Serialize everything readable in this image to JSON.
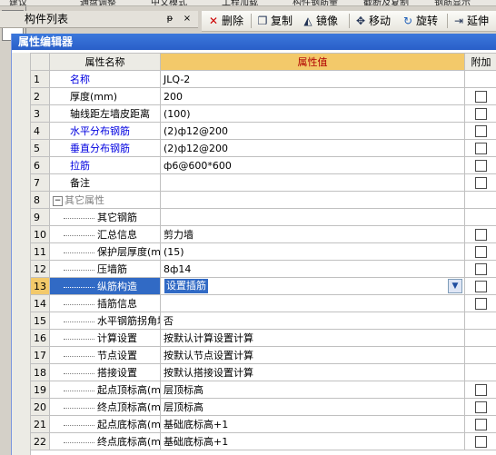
{
  "top_strip": [
    "建议",
    "通盘调整",
    "中文模式",
    "工程加载",
    "构件钢筋量",
    "截断及复制",
    "钢筋显示"
  ],
  "component_list": {
    "title": "构件列表",
    "pin": "ᵽ",
    "close": "×"
  },
  "toolbar": {
    "delete_label": "删除",
    "copy_label": "复制",
    "mirror_label": "镜像",
    "move_label": "移动",
    "rotate_label": "旋转",
    "extend_label": "延伸"
  },
  "editor": {
    "title": "属性编辑器",
    "col_name": "属性名称",
    "col_value": "属性值",
    "col_extra": "附加",
    "rows": [
      {
        "num": "1",
        "name": "名称",
        "value": "JLQ-2",
        "style": "blue",
        "indent": false,
        "check": false
      },
      {
        "num": "2",
        "name": "厚度(mm)",
        "value": "200",
        "style": "normal",
        "indent": false,
        "check": true
      },
      {
        "num": "3",
        "name": "轴线距左墙皮距离",
        "value": "(100)",
        "style": "normal",
        "indent": false,
        "check": true
      },
      {
        "num": "4",
        "name": "水平分布钢筋",
        "value": "(2)ф12@200",
        "style": "blue",
        "indent": false,
        "check": true
      },
      {
        "num": "5",
        "name": "垂直分布钢筋",
        "value": "(2)ф12@200",
        "style": "blue",
        "indent": false,
        "check": true
      },
      {
        "num": "6",
        "name": "拉筋",
        "value": "ф6@600*600",
        "style": "blue",
        "indent": false,
        "check": true
      },
      {
        "num": "7",
        "name": "备注",
        "value": "",
        "style": "normal",
        "indent": false,
        "check": true
      },
      {
        "num": "8",
        "name": "其它属性",
        "value": "",
        "style": "gray",
        "indent": false,
        "group": true,
        "check": false
      },
      {
        "num": "9",
        "name": "其它钢筋",
        "value": "",
        "style": "normal",
        "indent": true,
        "check": false
      },
      {
        "num": "10",
        "name": "汇总信息",
        "value": "剪力墙",
        "style": "normal",
        "indent": true,
        "check": true
      },
      {
        "num": "11",
        "name": "保护层厚度(mm)",
        "value": "(15)",
        "style": "normal",
        "indent": true,
        "check": true
      },
      {
        "num": "12",
        "name": "压墙筋",
        "value": "8ф14",
        "style": "normal",
        "indent": true,
        "check": true
      },
      {
        "num": "13",
        "name": "纵筋构造",
        "value": "设置插筋",
        "style": "normal",
        "indent": true,
        "selected": true,
        "check": true
      },
      {
        "num": "14",
        "name": "插筋信息",
        "value": "",
        "style": "normal",
        "indent": true,
        "check": true
      },
      {
        "num": "15",
        "name": "水平钢筋拐角增",
        "value": "否",
        "style": "normal",
        "indent": true,
        "check": false
      },
      {
        "num": "16",
        "name": "计算设置",
        "value": "按默认计算设置计算",
        "style": "normal",
        "indent": true,
        "check": false
      },
      {
        "num": "17",
        "name": "节点设置",
        "value": "按默认节点设置计算",
        "style": "normal",
        "indent": true,
        "check": false
      },
      {
        "num": "18",
        "name": "搭接设置",
        "value": "按默认搭接设置计算",
        "style": "normal",
        "indent": true,
        "check": false
      },
      {
        "num": "19",
        "name": "起点顶标高(m)",
        "value": "层顶标高",
        "style": "normal",
        "indent": true,
        "check": true
      },
      {
        "num": "20",
        "name": "终点顶标高(m)",
        "value": "层顶标高",
        "style": "normal",
        "indent": true,
        "check": true
      },
      {
        "num": "21",
        "name": "起点底标高(m)",
        "value": "基础底标高+1",
        "style": "normal",
        "indent": true,
        "check": true
      },
      {
        "num": "22",
        "name": "终点底标高(m)",
        "value": "基础底标高+1",
        "style": "normal",
        "indent": true,
        "check": true
      }
    ]
  },
  "icons": {
    "delete": "delete-icon",
    "copy": "copy-icon",
    "mirror": "mirror-icon",
    "move": "move-icon",
    "rotate": "rotate-icon",
    "extend": "extend-icon",
    "dropdown": "chevron-down-icon"
  },
  "colors": {
    "title_bar": "#2a5fc8",
    "header_value": "#f3c96a",
    "link_blue": "#0000e0",
    "selection": "#316ac5"
  }
}
